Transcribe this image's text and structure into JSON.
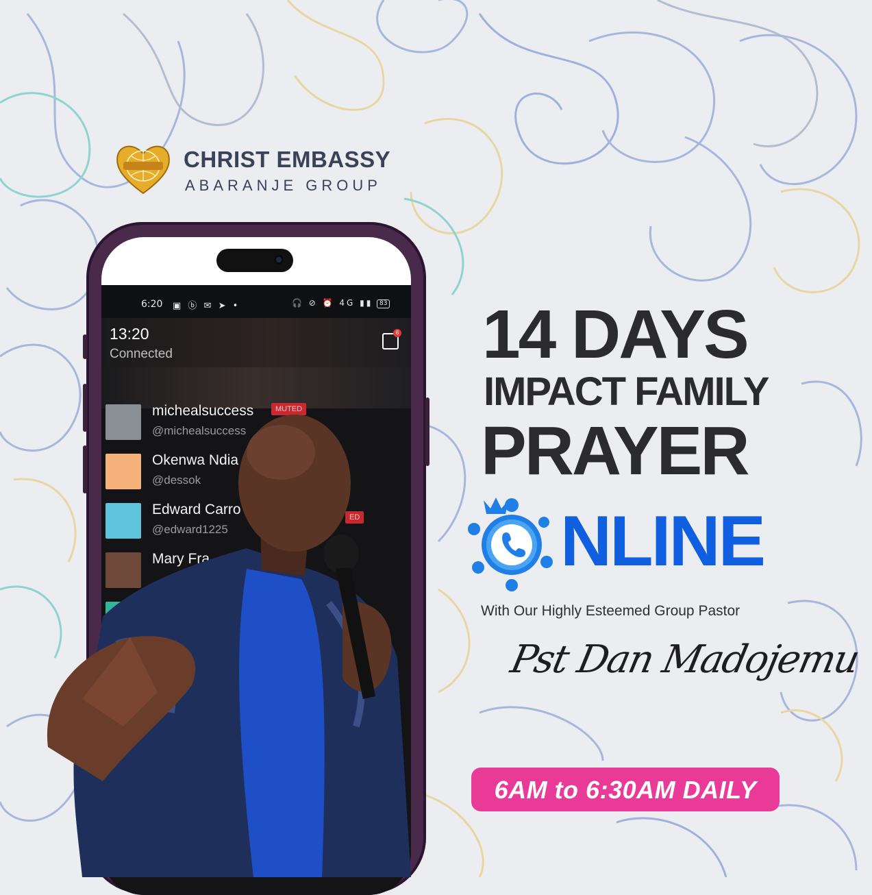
{
  "brand": {
    "org_name": "CHRIST EMBASSY",
    "group_name": "ABARANJE GROUP",
    "emblem_text": "LoveWorld",
    "logo_icon": "golden-heart-globe-icon"
  },
  "phone": {
    "status_bar": {
      "time": "6:20",
      "left_icons": "▣ ⓑ ✉ ➤ •",
      "right_icons": "🎧 ⊘ ⏰ 4G ▮▮",
      "battery": "83"
    },
    "call": {
      "duration": "13:20",
      "state": "Connected",
      "inbox_badge": "6"
    },
    "participants": [
      {
        "name": "michealsuccess",
        "handle": "@michealsuccess",
        "tag": "MUTED"
      },
      {
        "name": "Okenwa Ndia",
        "handle": "@dessok",
        "tag": ""
      },
      {
        "name": "Edward Carro",
        "handle": "@edward1225",
        "tag": "ED"
      },
      {
        "name": "Mary Fra",
        "handle": "",
        "tag": ""
      }
    ]
  },
  "headline": {
    "line1": "14 DAYS",
    "line2": "IMPACT FAMILY",
    "line3": "PRAYER",
    "online_word": "NLINE",
    "online_icon": "phone-call-group-icon"
  },
  "subtitle": "With Our Highly Esteemed Group Pastor",
  "pastor_signature": "Pst Dan Madojemu",
  "schedule": "6AM to 6:30AM DAILY",
  "colors": {
    "background": "#ecedf0",
    "heading": "#2b2b2f",
    "online_blue": "#0f5fe0",
    "pill_pink": "#e83a96",
    "logo_text": "#3a4258",
    "phone_frame": "#4a2a4a"
  }
}
